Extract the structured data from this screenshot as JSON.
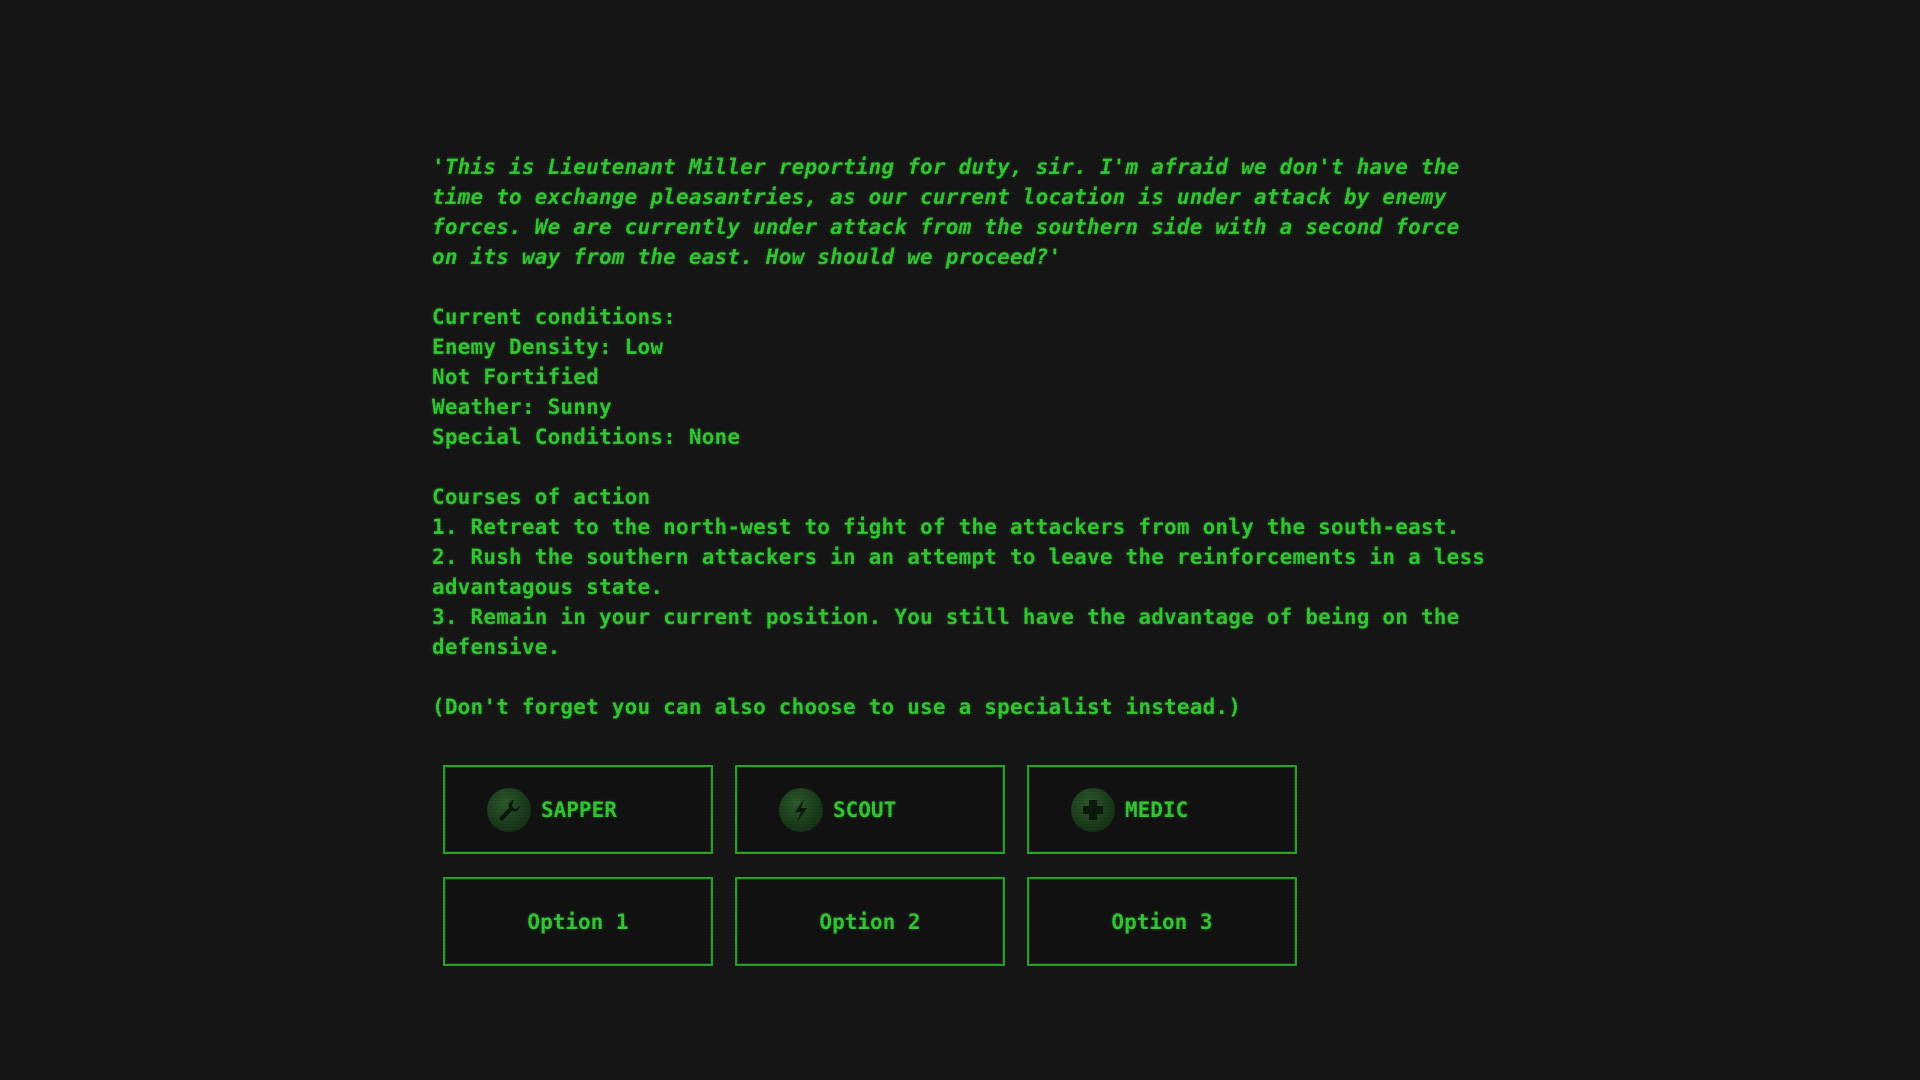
{
  "dialogue": {
    "quote": "'This is Lieutenant Miller reporting for duty, sir. I'm afraid we don't have the time to exchange pleasantries, as our current location is under attack by enemy forces. We are currently under attack from the southern side with a second force on its way from the east. How should we proceed?'"
  },
  "conditions": {
    "heading": "Current conditions:",
    "lines": [
      "Enemy Density: Low",
      "Not Fortified",
      "Weather: Sunny",
      "Special Conditions: None"
    ]
  },
  "courses": {
    "heading": "Courses of action",
    "items": [
      "1. Retreat to the north-west to fight of the attackers from only the south-east.",
      "2. Rush the southern attackers in an attempt to leave the reinforcements in a less advantagous state.",
      "3. Remain in your current position. You still have the advantage of being on the defensive."
    ]
  },
  "reminder": "(Don't forget you can also choose to use a specialist instead.)",
  "specialists": [
    {
      "label": "SAPPER",
      "icon": "wrench-icon"
    },
    {
      "label": "SCOUT",
      "icon": "lightning-icon"
    },
    {
      "label": "MEDIC",
      "icon": "cross-icon"
    }
  ],
  "options": [
    {
      "label": "Option 1"
    },
    {
      "label": "Option 2"
    },
    {
      "label": "Option 3"
    }
  ],
  "colors": {
    "background": "#161616",
    "text": "#35c935",
    "border": "#2aa32a"
  }
}
